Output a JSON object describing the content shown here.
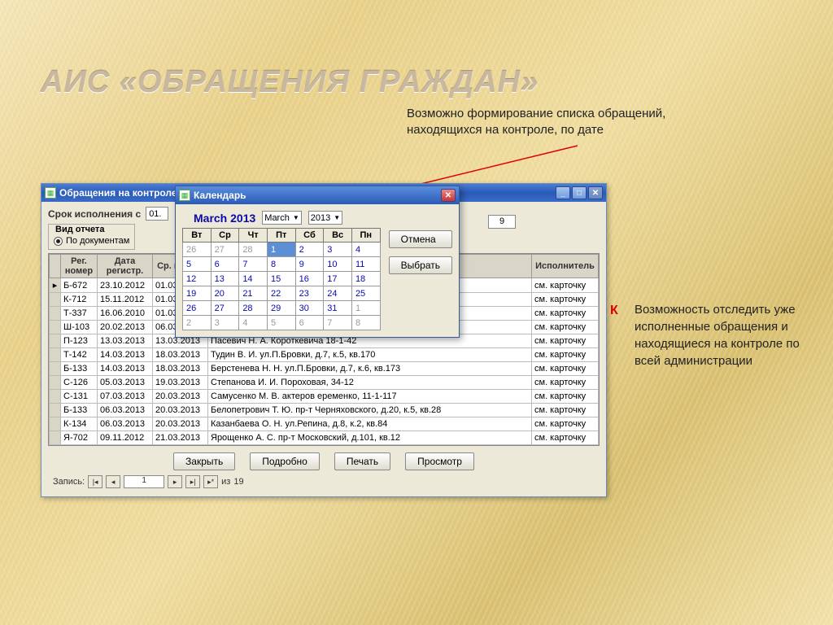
{
  "slide_title": "АИС «ОБРАЩЕНИЯ ГРАЖДАН»",
  "caption_top": "Возможно формирование списка обращений, находящихся на контроле, по дате",
  "caption_right": "Возможность отследить уже исполненные обращения и находящиеся на контроле по всей администрации",
  "red_marker": "К",
  "main_window": {
    "title": "Обращения на контроле",
    "srok_label": "Срок исполнения с",
    "srok_from": "01.",
    "report_type_label": "Вид отчета",
    "radio_label": "По документам",
    "badge9": "9",
    "columns": {
      "reg": "Рег. номер",
      "date": "Дата регистр.",
      "srok": "Ср. испол.",
      "desc": "",
      "exec": "Исполнитель"
    },
    "rows": [
      {
        "marker": "▸",
        "reg": "Б-672",
        "date": "23.10.2012",
        "srok": "01.03",
        "desc": "",
        "exec": "см. карточку"
      },
      {
        "marker": "",
        "reg": "К-712",
        "date": "15.11.2012",
        "srok": "01.03",
        "desc": "",
        "exec": "см. карточку"
      },
      {
        "marker": "",
        "reg": "Т-337",
        "date": "16.06.2010",
        "srok": "01.03",
        "desc": "",
        "exec": "см. карточку"
      },
      {
        "marker": "",
        "reg": "Ш-103",
        "date": "20.02.2013",
        "srok": "06.03",
        "desc": "",
        "exec": "см. карточку"
      },
      {
        "marker": "",
        "reg": "П-123",
        "date": "13.03.2013",
        "srok": "13.03.2013",
        "desc": "Пасевич Н. А. Короткевича 18-1-42",
        "exec": "см. карточку"
      },
      {
        "marker": "",
        "reg": "Т-142",
        "date": "14.03.2013",
        "srok": "18.03.2013",
        "desc": "Тудин В. И. ул.П.Бровки, д.7, к.5, кв.170",
        "exec": "см. карточку"
      },
      {
        "marker": "",
        "reg": "Б-133",
        "date": "14.03.2013",
        "srok": "18.03.2013",
        "desc": "Берстенева Н. Н. ул.П.Бровки, д.7, к.6, кв.173",
        "exec": "см. карточку"
      },
      {
        "marker": "",
        "reg": "С-126",
        "date": "05.03.2013",
        "srok": "19.03.2013",
        "desc": "Степанова И. И. Пороховая, 34-12",
        "exec": "см. карточку"
      },
      {
        "marker": "",
        "reg": "С-131",
        "date": "07.03.2013",
        "srok": "20.03.2013",
        "desc": "Самусенко М. В. актеров еременко, 11-1-117",
        "exec": "см. карточку"
      },
      {
        "marker": "",
        "reg": "Б-133",
        "date": "06.03.2013",
        "srok": "20.03.2013",
        "desc": "Белопетрович Т. Ю. пр-т Черняховского, д.20, к.5, кв.28",
        "exec": "см. карточку"
      },
      {
        "marker": "",
        "reg": "К-134",
        "date": "06.03.2013",
        "srok": "20.03.2013",
        "desc": "Казанбаева О. Н. ул.Репина, д.8, к.2, кв.84",
        "exec": "см. карточку"
      },
      {
        "marker": "",
        "reg": "Я-702",
        "date": "09.11.2012",
        "srok": "21.03.2013",
        "desc": "Ярощенко А. С. пр-т Московский, д.101, кв.12",
        "exec": "см. карточку"
      }
    ],
    "buttons": {
      "close": "Закрыть",
      "detail": "Подробно",
      "print": "Печать",
      "preview": "Просмотр"
    },
    "record_nav": {
      "label": "Запись:",
      "pos": "1",
      "of_label": "из",
      "total": "19"
    }
  },
  "calendar": {
    "title": "Календарь",
    "month_title": "March 2013",
    "month_select": "March",
    "year_select": "2013",
    "cancel": "Отмена",
    "select": "Выбрать",
    "weekdays": [
      "Вт",
      "Ср",
      "Чт",
      "Пт",
      "Сб",
      "Вс",
      "Пн"
    ],
    "rows": [
      [
        {
          "d": "26",
          "dim": true
        },
        {
          "d": "27",
          "dim": true
        },
        {
          "d": "28",
          "dim": true
        },
        {
          "d": "1",
          "sel": true
        },
        {
          "d": "2"
        },
        {
          "d": "3"
        },
        {
          "d": "4"
        }
      ],
      [
        {
          "d": "5"
        },
        {
          "d": "6"
        },
        {
          "d": "7"
        },
        {
          "d": "8"
        },
        {
          "d": "9"
        },
        {
          "d": "10"
        },
        {
          "d": "11"
        }
      ],
      [
        {
          "d": "12"
        },
        {
          "d": "13"
        },
        {
          "d": "14"
        },
        {
          "d": "15"
        },
        {
          "d": "16"
        },
        {
          "d": "17"
        },
        {
          "d": "18"
        }
      ],
      [
        {
          "d": "19"
        },
        {
          "d": "20"
        },
        {
          "d": "21"
        },
        {
          "d": "22"
        },
        {
          "d": "23"
        },
        {
          "d": "24"
        },
        {
          "d": "25"
        }
      ],
      [
        {
          "d": "26"
        },
        {
          "d": "27"
        },
        {
          "d": "28"
        },
        {
          "d": "29"
        },
        {
          "d": "30"
        },
        {
          "d": "31"
        },
        {
          "d": "1",
          "dim": true
        }
      ],
      [
        {
          "d": "2",
          "dim": true
        },
        {
          "d": "3",
          "dim": true
        },
        {
          "d": "4",
          "dim": true
        },
        {
          "d": "5",
          "dim": true
        },
        {
          "d": "6",
          "dim": true
        },
        {
          "d": "7",
          "dim": true
        },
        {
          "d": "8",
          "dim": true
        }
      ]
    ]
  }
}
